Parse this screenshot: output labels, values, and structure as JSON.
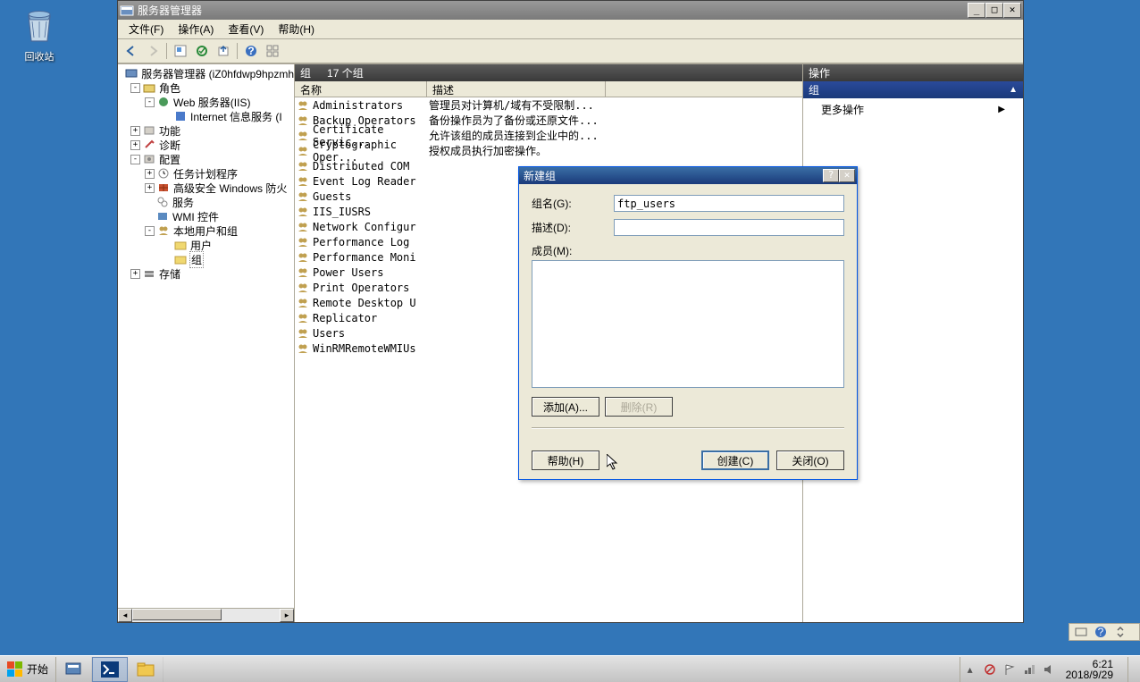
{
  "desktop": {
    "recycle_label": "回收站"
  },
  "window": {
    "title": "服务器管理器",
    "menu": {
      "file": "文件(F)",
      "action": "操作(A)",
      "view": "查看(V)",
      "help": "帮助(H)"
    },
    "tree": {
      "root": "服务器管理器 (iZ0hfdwp9hpzmh",
      "roles": "角色",
      "iis": "Web 服务器(IIS)",
      "iis_sub": "Internet 信息服务 (I",
      "features": "功能",
      "diag": "诊断",
      "config": "配置",
      "task": "任务计划程序",
      "firewall": "高级安全 Windows 防火",
      "services": "服务",
      "wmi": "WMI 控件",
      "localug": "本地用户和组",
      "users": "用户",
      "groups": "组",
      "storage": "存储"
    },
    "center": {
      "heading": "组",
      "count": "17 个组",
      "col_name": "名称",
      "col_desc": "描述",
      "rows": [
        {
          "name": "Administrators",
          "desc": "管理员对计算机/域有不受限制..."
        },
        {
          "name": "Backup Operators",
          "desc": "备份操作员为了备份或还原文件..."
        },
        {
          "name": "Certificate Servic...",
          "desc": "允许该组的成员连接到企业中的..."
        },
        {
          "name": "Cryptographic Oper...",
          "desc": "授权成员执行加密操作。"
        },
        {
          "name": "Distributed COM",
          "desc": ""
        },
        {
          "name": "Event Log Reader",
          "desc": ""
        },
        {
          "name": "Guests",
          "desc": ""
        },
        {
          "name": "IIS_IUSRS",
          "desc": ""
        },
        {
          "name": "Network Configur",
          "desc": ""
        },
        {
          "name": "Performance Log",
          "desc": ""
        },
        {
          "name": "Performance Moni",
          "desc": ""
        },
        {
          "name": "Power Users",
          "desc": ""
        },
        {
          "name": "Print Operators",
          "desc": ""
        },
        {
          "name": "Remote Desktop U",
          "desc": ""
        },
        {
          "name": "Replicator",
          "desc": ""
        },
        {
          "name": "Users",
          "desc": ""
        },
        {
          "name": "WinRMRemoteWMIUs",
          "desc": ""
        }
      ]
    },
    "actions": {
      "heading": "操作",
      "group": "组",
      "more": "更多操作"
    }
  },
  "dialog": {
    "title": "新建组",
    "group_name_label": "组名(G):",
    "group_name_value": "ftp_users",
    "desc_label": "描述(D):",
    "desc_value": "",
    "members_label": "成员(M):",
    "add": "添加(A)...",
    "remove": "删除(R)",
    "help": "帮助(H)",
    "create": "创建(C)",
    "close": "关闭(O)"
  },
  "taskbar": {
    "start": "开始",
    "time": "6:21",
    "date": "2018/9/29"
  }
}
